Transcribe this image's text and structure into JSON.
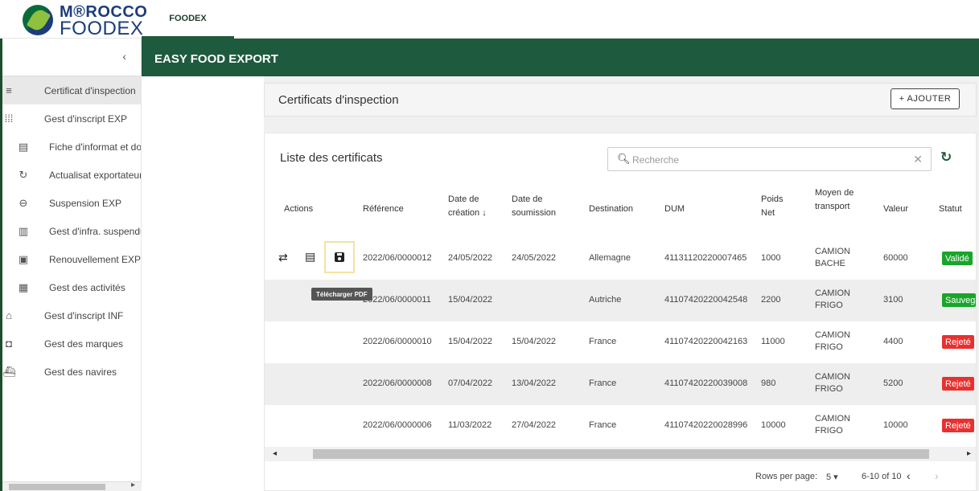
{
  "brand": {
    "line1": "M®ROCCO",
    "line2": "FOODEX"
  },
  "top_tab": "FOODEX",
  "banner": "EASY FOOD EXPORT",
  "sidebar": {
    "collapse": "‹",
    "items": [
      {
        "icon": "≡",
        "label": "Certificat d'inspection"
      },
      {
        "icon": "⁞⁞⁞",
        "label": "Gest d'inscript EXP"
      },
      {
        "icon": "▤",
        "label": "Fiche d'informat et do"
      },
      {
        "icon": "↻",
        "label": "Actualisat exportateur"
      },
      {
        "icon": "⊖",
        "label": "Suspension EXP"
      },
      {
        "icon": "▥",
        "label": "Gest d'infra. suspendu"
      },
      {
        "icon": "▣",
        "label": "Renouvellement EXP"
      },
      {
        "icon": "▦",
        "label": "Gest des activités"
      },
      {
        "icon": "⌂",
        "label": "Gest d'inscript INF"
      },
      {
        "icon": "◘",
        "label": "Gest des marques"
      },
      {
        "icon": "⛴",
        "label": "Gest des navires"
      }
    ]
  },
  "page": {
    "title": "Certificats d'inspection",
    "add_button": "+ AJOUTER"
  },
  "list": {
    "title": "Liste des certificats",
    "search_placeholder": "Recherche"
  },
  "columns": {
    "actions": "Actions",
    "reference": "Référence",
    "date_creation": "Date de création ↓",
    "date_soumission": "Date de soumission",
    "destination": "Destination",
    "dum": "DUM",
    "poids": "Poids Net",
    "moyen": "Moyen de transport",
    "valeur": "Valeur",
    "statut": "Statut"
  },
  "tooltip": "Télécharger PDF",
  "rows": [
    {
      "ref": "2022/06/0000012",
      "creation": "24/05/2022",
      "soumission": "24/05/2022",
      "dest": "Allemagne",
      "dum": "41131120220007465",
      "poids": "1000",
      "moyen": "CAMION BACHE",
      "valeur": "60000",
      "statut": "Validé",
      "color": "#1aa52a"
    },
    {
      "ref": "2022/06/0000011",
      "creation": "15/04/2022",
      "soumission": "",
      "dest": "Autriche",
      "dum": "41107420220042548",
      "poids": "2200",
      "moyen": "CAMION FRIGO",
      "valeur": "3100",
      "statut": "Sauvegardé",
      "color": "#1aa52a"
    },
    {
      "ref": "2022/06/0000010",
      "creation": "15/04/2022",
      "soumission": "15/04/2022",
      "dest": "France",
      "dum": "41107420220042163",
      "poids": "11000",
      "moyen": "CAMION FRIGO",
      "valeur": "4400",
      "statut": "Rejeté",
      "color": "#e8312f"
    },
    {
      "ref": "2022/06/0000008",
      "creation": "07/04/2022",
      "soumission": "13/04/2022",
      "dest": "France",
      "dum": "41107420220039008",
      "poids": "980",
      "moyen": "CAMION FRIGO",
      "valeur": "5200",
      "statut": "Rejeté",
      "color": "#e8312f"
    },
    {
      "ref": "2022/06/0000006",
      "creation": "11/03/2022",
      "soumission": "27/04/2022",
      "dest": "France",
      "dum": "41107420220028996",
      "poids": "10000",
      "moyen": "CAMION FRIGO",
      "valeur": "10000",
      "statut": "Rejeté",
      "color": "#e8312f"
    }
  ],
  "pager": {
    "rows_per_page": "Rows per page:",
    "selected": "5 ▾",
    "range": "6-10 of 10",
    "prev": "‹",
    "next": "›"
  }
}
